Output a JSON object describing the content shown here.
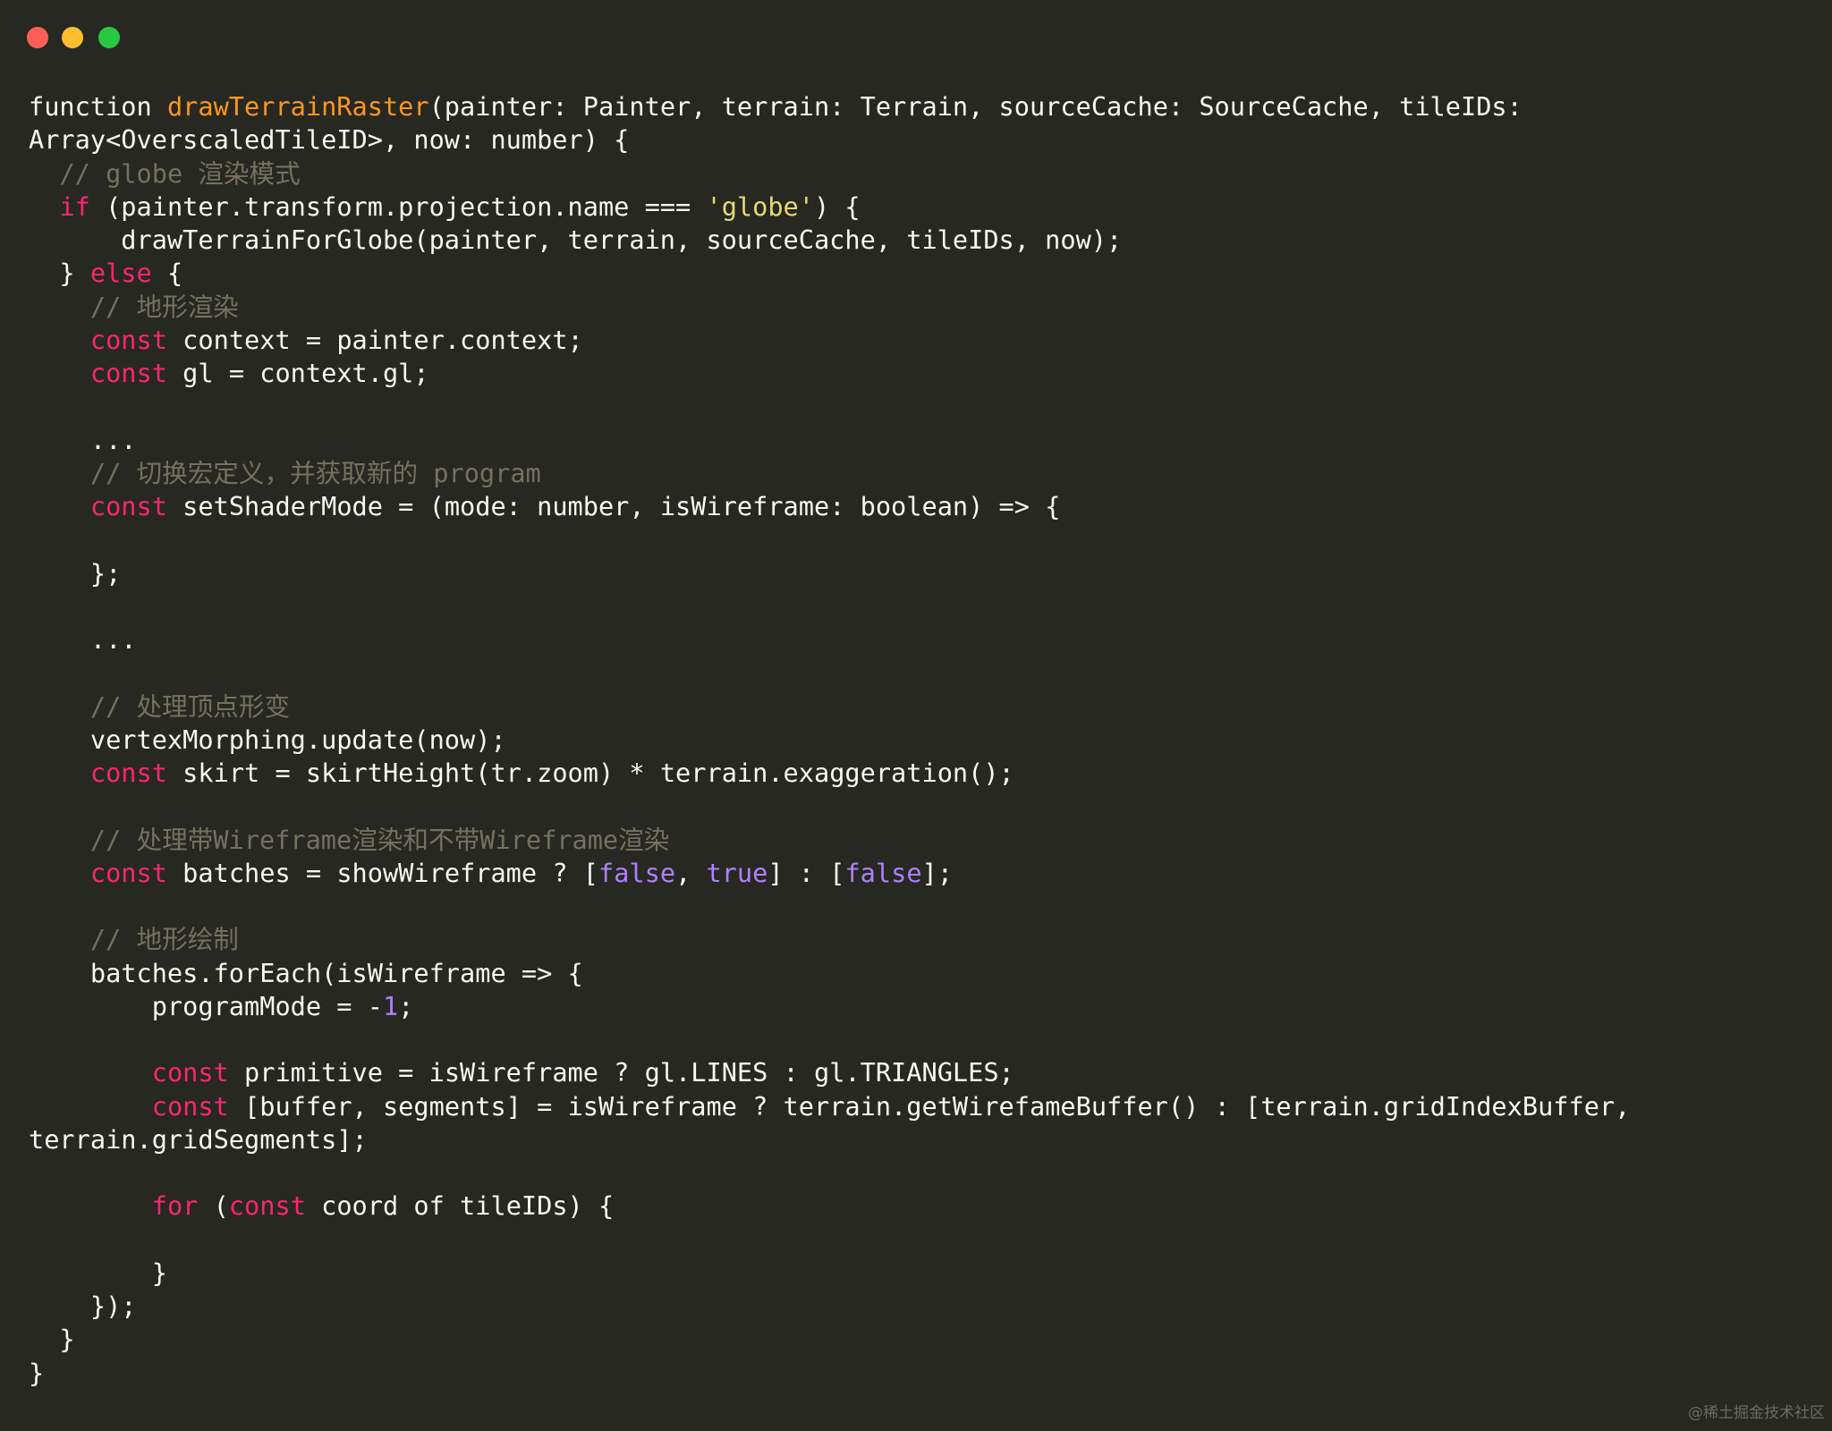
{
  "window": {
    "traffic_lights": [
      {
        "name": "close",
        "color": "#ff5f56"
      },
      {
        "name": "minimize",
        "color": "#ffbd2e"
      },
      {
        "name": "maximize",
        "color": "#27c93f"
      }
    ]
  },
  "theme": {
    "background": "#272822",
    "plain": "#f8f8f2",
    "keyword": "#f92672",
    "function": "#fd971f",
    "string": "#e6db74",
    "constant": "#ae81ff",
    "comment": "#75715e"
  },
  "code_lines": [
    [
      [
        "plain",
        "function "
      ],
      [
        "fn",
        "drawTerrainRaster"
      ],
      [
        "plain",
        "(painter: Painter, terrain: Terrain, sourceCache: SourceCache, tileIDs:"
      ]
    ],
    [
      [
        "plain",
        "Array<OverscaledTileID>, now: number) {"
      ]
    ],
    [
      [
        "plain",
        "  "
      ],
      [
        "comment",
        "// globe 渲染模式"
      ]
    ],
    [
      [
        "plain",
        "  "
      ],
      [
        "kw",
        "if"
      ],
      [
        "plain",
        " (painter.transform.projection.name === "
      ],
      [
        "str",
        "'globe'"
      ],
      [
        "plain",
        ") {"
      ]
    ],
    [
      [
        "plain",
        "      drawTerrainForGlobe(painter, terrain, sourceCache, tileIDs, now);"
      ]
    ],
    [
      [
        "plain",
        "  } "
      ],
      [
        "kw",
        "else"
      ],
      [
        "plain",
        " {"
      ]
    ],
    [
      [
        "plain",
        "    "
      ],
      [
        "comment",
        "// 地形渲染"
      ]
    ],
    [
      [
        "plain",
        "    "
      ],
      [
        "kw",
        "const"
      ],
      [
        "plain",
        " context = painter.context;"
      ]
    ],
    [
      [
        "plain",
        "    "
      ],
      [
        "kw",
        "const"
      ],
      [
        "plain",
        " gl = context.gl;"
      ]
    ],
    [],
    [
      [
        "plain",
        "    ..."
      ]
    ],
    [
      [
        "plain",
        "    "
      ],
      [
        "comment",
        "// 切换宏定义，并获取新的 program"
      ]
    ],
    [
      [
        "plain",
        "    "
      ],
      [
        "kw",
        "const"
      ],
      [
        "plain",
        " setShaderMode = (mode: number, isWireframe: boolean) => {"
      ]
    ],
    [],
    [
      [
        "plain",
        "    };"
      ]
    ],
    [],
    [
      [
        "plain",
        "    ..."
      ]
    ],
    [],
    [
      [
        "plain",
        "    "
      ],
      [
        "comment",
        "// 处理顶点形变"
      ]
    ],
    [
      [
        "plain",
        "    vertexMorphing.update(now);"
      ]
    ],
    [
      [
        "plain",
        "    "
      ],
      [
        "kw",
        "const"
      ],
      [
        "plain",
        " skirt = skirtHeight(tr.zoom) * terrain.exaggeration();"
      ]
    ],
    [],
    [
      [
        "plain",
        "    "
      ],
      [
        "comment",
        "// 处理带Wireframe渲染和不带Wireframe渲染"
      ]
    ],
    [
      [
        "plain",
        "    "
      ],
      [
        "kw",
        "const"
      ],
      [
        "plain",
        " batches = showWireframe ? ["
      ],
      [
        "const",
        "false"
      ],
      [
        "plain",
        ", "
      ],
      [
        "const",
        "true"
      ],
      [
        "plain",
        "] : ["
      ],
      [
        "const",
        "false"
      ],
      [
        "plain",
        "];"
      ]
    ],
    [],
    [
      [
        "plain",
        "    "
      ],
      [
        "comment",
        "// 地形绘制"
      ]
    ],
    [
      [
        "plain",
        "    batches.forEach(isWireframe => {"
      ]
    ],
    [
      [
        "plain",
        "        programMode = -"
      ],
      [
        "const",
        "1"
      ],
      [
        "plain",
        ";"
      ]
    ],
    [],
    [
      [
        "plain",
        "        "
      ],
      [
        "kw",
        "const"
      ],
      [
        "plain",
        " primitive = isWireframe ? gl.LINES : gl.TRIANGLES;"
      ]
    ],
    [
      [
        "plain",
        "        "
      ],
      [
        "kw",
        "const"
      ],
      [
        "plain",
        " [buffer, segments] = isWireframe ? terrain.getWirefameBuffer() : [terrain.gridIndexBuffer,"
      ]
    ],
    [
      [
        "plain",
        "terrain.gridSegments];"
      ]
    ],
    [],
    [
      [
        "plain",
        "        "
      ],
      [
        "kw",
        "for"
      ],
      [
        "plain",
        " ("
      ],
      [
        "kw",
        "const"
      ],
      [
        "plain",
        " coord of tileIDs) {"
      ]
    ],
    [],
    [
      [
        "plain",
        "        }"
      ]
    ],
    [
      [
        "plain",
        "    });"
      ]
    ],
    [
      [
        "plain",
        "  }"
      ]
    ],
    [
      [
        "plain",
        "}"
      ]
    ]
  ],
  "watermark": "@稀土掘金技术社区"
}
